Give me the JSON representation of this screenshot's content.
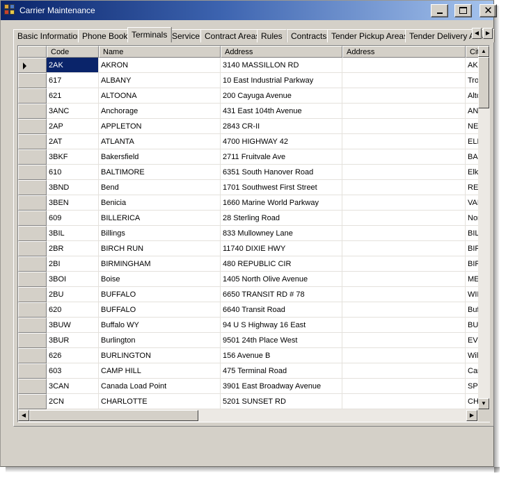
{
  "window": {
    "title": "Carrier Maintenance"
  },
  "title_buttons": {
    "minimize": "",
    "maximize": "",
    "close": "✕"
  },
  "tabs": [
    {
      "label": "Basic Information"
    },
    {
      "label": "Phone Book"
    },
    {
      "label": "Terminals",
      "active": true
    },
    {
      "label": "Service"
    },
    {
      "label": "Contract Areas"
    },
    {
      "label": "Rules"
    },
    {
      "label": "Contracts"
    },
    {
      "label": "Tender Pickup Areas"
    },
    {
      "label": "Tender Delivery Areas"
    }
  ],
  "tab_scroll": {
    "prev": "◀",
    "next": "▶"
  },
  "grid": {
    "columns": [
      "Code",
      "Name",
      "Address",
      "Address",
      "City"
    ],
    "selected_row": 0,
    "rows": [
      {
        "code": "2AK",
        "name": "AKRON",
        "address1": "3140 MASSILLON RD",
        "address2": "",
        "city": "AKRON"
      },
      {
        "code": "617",
        "name": "ALBANY",
        "address1": "10 East Industrial Parkway",
        "address2": "",
        "city": "Troy"
      },
      {
        "code": "621",
        "name": "ALTOONA",
        "address1": "200 Cayuga Avenue",
        "address2": "",
        "city": "Altoona"
      },
      {
        "code": "3ANC",
        "name": "Anchorage",
        "address1": "431 East 104th Avenue",
        "address2": "",
        "city": "ANCHORAGE"
      },
      {
        "code": "2AP",
        "name": "APPLETON",
        "address1": "2843 CR-II",
        "address2": "",
        "city": "NEENAH"
      },
      {
        "code": "2AT",
        "name": "ATLANTA",
        "address1": "4700 HIGHWAY 42",
        "address2": "",
        "city": "ELLENWOOD"
      },
      {
        "code": "3BKF",
        "name": "Bakersfield",
        "address1": "2711 Fruitvale Ave",
        "address2": "",
        "city": "BAKERSFIELD"
      },
      {
        "code": "610",
        "name": "BALTIMORE",
        "address1": "6351 South Hanover Road",
        "address2": "",
        "city": "Elkridge"
      },
      {
        "code": "3BND",
        "name": "Bend",
        "address1": "1701 Southwest First Street",
        "address2": "",
        "city": "REDMOND"
      },
      {
        "code": "3BEN",
        "name": "Benicia",
        "address1": "1660 Marine World Parkway",
        "address2": "",
        "city": "VALLEJO"
      },
      {
        "code": "609",
        "name": "BILLERICA",
        "address1": "28 Sterling Road",
        "address2": "",
        "city": "North Billerica"
      },
      {
        "code": "3BIL",
        "name": "Billings",
        "address1": "833 Mullowney Lane",
        "address2": "",
        "city": "BILLINGS"
      },
      {
        "code": "2BR",
        "name": "BIRCH RUN",
        "address1": "11740 DIXIE HWY",
        "address2": "",
        "city": "BIRCH RUN"
      },
      {
        "code": "2BI",
        "name": "BIRMINGHAM",
        "address1": "480 REPUBLIC CIR",
        "address2": "",
        "city": "BIRMINGHAM"
      },
      {
        "code": "3BOI",
        "name": "Boise",
        "address1": "1405 North Olive Avenue",
        "address2": "",
        "city": "MERIDIAN"
      },
      {
        "code": "2BU",
        "name": "BUFFALO",
        "address1": "6650 TRANSIT RD # 78",
        "address2": "",
        "city": "WILLIAMSVILLE"
      },
      {
        "code": "620",
        "name": "BUFFALO",
        "address1": "6640 Transit Road",
        "address2": "",
        "city": "Buffalo"
      },
      {
        "code": "3BUW",
        "name": "Buffalo  WY",
        "address1": "94 U S Highway 16 East",
        "address2": "",
        "city": "BUFFALO"
      },
      {
        "code": "3BUR",
        "name": "Burlington",
        "address1": "9501 24th Place West",
        "address2": "",
        "city": "EVERETT"
      },
      {
        "code": "626",
        "name": "BURLINGTON",
        "address1": "156 Avenue B",
        "address2": "",
        "city": "Williston"
      },
      {
        "code": "603",
        "name": "CAMP HILL",
        "address1": "475 Terminal Road",
        "address2": "",
        "city": "Camp Hill"
      },
      {
        "code": "3CAN",
        "name": "Canada Load Point",
        "address1": "3901 East Broadway Avenue",
        "address2": "",
        "city": "SPOKANE"
      },
      {
        "code": "2CN",
        "name": "CHARLOTTE",
        "address1": "5201 SUNSET RD",
        "address2": "",
        "city": "CHARLOTTE"
      }
    ]
  },
  "scrollbars": {
    "up": "▲",
    "down": "▼",
    "left": "◀",
    "right": "▶"
  },
  "colors": {
    "titlebar_start": "#0a246a",
    "titlebar_end": "#a6c4ee",
    "face": "#d4d0c8",
    "selection": "#0a246a"
  }
}
